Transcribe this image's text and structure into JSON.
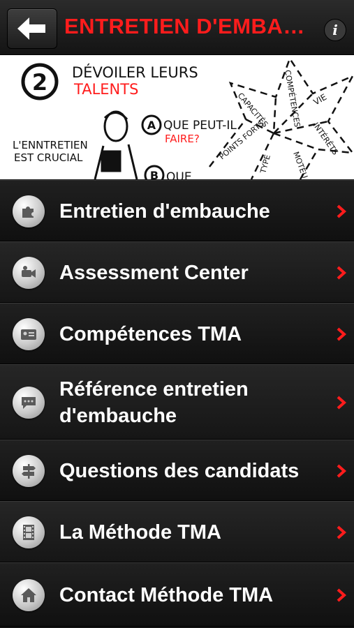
{
  "header": {
    "title": "ENTRETIEN D'EMBA…",
    "back_icon": "back-arrow-icon",
    "info_label": "i"
  },
  "banner": {
    "step_number": "2",
    "heading_line1": "DÉVOILER LEURS",
    "heading_line2": "TALENTS",
    "crucial_line1": "L'ENNTRETIEN",
    "crucial_line2": "EST CRUCIAL",
    "bullet_a": "A",
    "question_a_line1": "QUE PEUT-IL",
    "question_a_line2": "FAIRE?",
    "bullet_b": "B",
    "question_b_partial": "QUE",
    "star_words": [
      "CAPACITÉS",
      "COMPÉTENCES",
      "VIE",
      "INTÉRÊTS",
      "POINTS FORTS",
      "TYPE",
      "MOTEU"
    ]
  },
  "menu": {
    "items": [
      {
        "label": "Entretien d'embauche",
        "icon": "puzzle-icon"
      },
      {
        "label": "Assessment Center",
        "icon": "video-camera-icon"
      },
      {
        "label": "Compétences TMA",
        "icon": "id-card-icon"
      },
      {
        "label": "Référence entretien d'embauche",
        "icon": "speech-bubble-icon"
      },
      {
        "label": "Questions des candidats",
        "icon": "signpost-icon"
      },
      {
        "label": "La Méthode TMA",
        "icon": "film-strip-icon"
      },
      {
        "label": "Contact Méthode TMA",
        "icon": "home-icon"
      }
    ]
  },
  "colors": {
    "accent": "#ff1c1c",
    "background": "#121212",
    "text": "#ffffff"
  }
}
